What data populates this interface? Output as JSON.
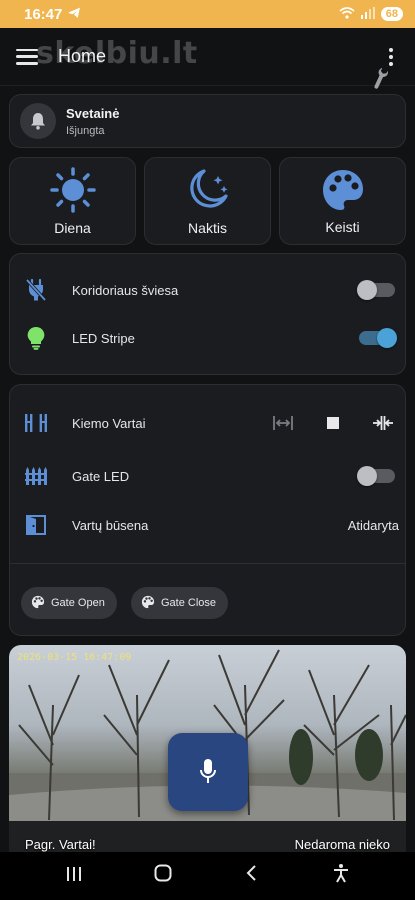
{
  "status": {
    "time": "16:47",
    "battery": "68"
  },
  "appbar": {
    "title": "Home",
    "watermark": "skelbiu.lt"
  },
  "alarm": {
    "name": "Svetainė",
    "state": "Išjungta"
  },
  "scenes": [
    {
      "label": "Diena",
      "icon": "sun-icon"
    },
    {
      "label": "Naktis",
      "icon": "moon-stars-icon"
    },
    {
      "label": "Keisti",
      "icon": "palette-icon"
    }
  ],
  "lights": {
    "corridor": {
      "label": "Koridoriaus šviesa",
      "on": false
    },
    "led_stripe": {
      "label": "LED Stripe",
      "on": true
    }
  },
  "gate": {
    "kiemo_label": "Kiemo Vartai",
    "gate_led_label": "Gate LED",
    "gate_led_on": false,
    "state_label": "Vartų būsena",
    "state_value": "Atidaryta",
    "chips": [
      "Gate Open",
      "Gate Close"
    ]
  },
  "camera": {
    "timestamp": "2026-03-15 16:47:09",
    "caption_left": "Pagr. Vartai!",
    "caption_right": "Nedaroma nieko"
  },
  "colors": {
    "accent": "#4aa2d9",
    "icon_blue": "#5c8fd6",
    "led_green": "#7fe36a",
    "status_bar": "#f0b54e"
  }
}
